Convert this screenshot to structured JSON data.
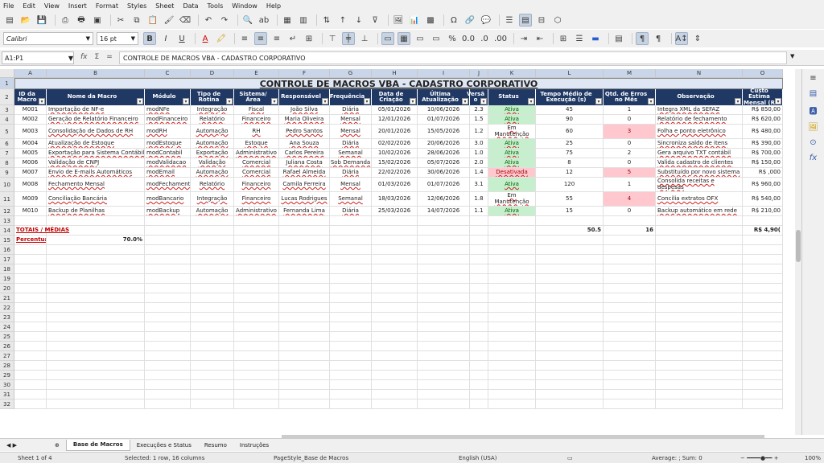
{
  "menu": [
    "File",
    "Edit",
    "View",
    "Insert",
    "Format",
    "Styles",
    "Sheet",
    "Data",
    "Tools",
    "Window",
    "Help"
  ],
  "font": {
    "name": "Calibri",
    "size": "16 pt"
  },
  "namebox": "A1:P1",
  "formula": "CONTROLE DE MACROS VBA - CADASTRO CORPORATIVO",
  "columns": [
    "A",
    "B",
    "C",
    "D",
    "E",
    "F",
    "G",
    "H",
    "I",
    "J",
    "K",
    "L",
    "M",
    "N",
    "O"
  ],
  "rows": [
    "1",
    "2",
    "3",
    "4",
    "5",
    "6",
    "7",
    "8",
    "9",
    "10",
    "11",
    "12",
    "13",
    "14",
    "15",
    "16",
    "17",
    "18",
    "19",
    "20",
    "21",
    "22",
    "23",
    "24",
    "25",
    "26",
    "27",
    "28",
    "29",
    "30",
    "31",
    "32"
  ],
  "title": "CONTROLE DE MACROS VBA - CADASTRO CORPORATIVO",
  "headers": [
    "ID da Macro",
    "Nome da Macro",
    "Módulo",
    "Tipo de Rotina",
    "Sistema/ Área",
    "Responsável",
    "Frequência",
    "Data de Criação",
    "Última Atualização",
    "Versã o",
    "Status",
    "Tempo Médio de Execução (s)",
    "Qtd. de Erros no Mês",
    "Observação",
    "Custo Estima Mensal (R"
  ],
  "data": [
    [
      "M001",
      "Importação de NF-e",
      "modNFe",
      "Integração",
      "Fiscal",
      "João Silva",
      "Diária",
      "05/01/2026",
      "10/06/2026",
      "2.3",
      "Ativa",
      "45",
      "1",
      "Integra XML da SEFAZ",
      "R$ 850,00"
    ],
    [
      "M002",
      "Geração de Relatório Financeiro",
      "modFinanceiro",
      "Relatório",
      "Financeiro",
      "Maria Oliveira",
      "Mensal",
      "12/01/2026",
      "01/07/2026",
      "1.5",
      "Ativa",
      "90",
      "0",
      "Relatório de fechamento",
      "R$ 620,00"
    ],
    [
      "M003",
      "Consolidação de Dados de RH",
      "modRH",
      "Automação",
      "RH",
      "Pedro Santos",
      "Mensal",
      "20/01/2026",
      "15/05/2026",
      "1.2",
      "Em Manutenção",
      "60",
      "3",
      "Folha e ponto eletrônico",
      "R$ 480,00"
    ],
    [
      "M004",
      "Atualização de Estoque",
      "modEstoque",
      "Automação",
      "Estoque",
      "Ana Souza",
      "Diária",
      "02/02/2026",
      "20/06/2026",
      "3.0",
      "Ativa",
      "25",
      "0",
      "Sincroniza saldo de itens",
      "R$ 390,00"
    ],
    [
      "M005",
      "Exportação para Sistema Contábil",
      "modContabil",
      "Exportação",
      "Administrativo",
      "Carlos Pereira",
      "Semanal",
      "10/02/2026",
      "28/06/2026",
      "1.0",
      "Ativa",
      "75",
      "2",
      "Gera arquivo TXT contábil",
      "R$ 700,00"
    ],
    [
      "M006",
      "Validação de CNPJ",
      "modValidacao",
      "Validação",
      "Comercial",
      "Juliana Costa",
      "Sob Demanda",
      "15/02/2026",
      "05/07/2026",
      "2.0",
      "Ativa",
      "8",
      "0",
      "Valida cadastro de clientes",
      "R$ 150,00"
    ],
    [
      "M007",
      "Envio de E-mails Automáticos",
      "modEmail",
      "Automação",
      "Comercial",
      "Rafael Almeida",
      "Diária",
      "22/02/2026",
      "30/06/2026",
      "1.4",
      "Desativada",
      "12",
      "5",
      "Substituído por novo sistema",
      "R$ ,000"
    ],
    [
      "M008",
      "Fechamento Mensal",
      "modFechamento",
      "Relatório",
      "Financeiro",
      "Camila Ferreira",
      "Mensal",
      "01/03/2026",
      "01/07/2026",
      "3.1",
      "Ativa",
      "120",
      "1",
      "Consolida receitas e despesas",
      "R$ 960,00"
    ],
    [
      "M009",
      "Conciliação Bancária",
      "modBancario",
      "Integração",
      "Financeiro",
      "Lucas Rodrigues",
      "Semanal",
      "18/03/2026",
      "12/06/2026",
      "1.8",
      "Em Manutenção",
      "55",
      "4",
      "Concilia extratos OFX",
      "R$ 540,00"
    ],
    [
      "M010",
      "Backup de Planilhas",
      "modBackup",
      "Automação",
      "Administrativo",
      "Fernanda Lima",
      "Diária",
      "25/03/2026",
      "14/07/2026",
      "1.1",
      "Ativa",
      "15",
      "0",
      "Backup automático em rede",
      "R$ 210,00"
    ]
  ],
  "totals": {
    "label": "TOTAIS / MÉDIAS",
    "avg_time": "50.5",
    "errors": "16",
    "cost": "R$ 4,90("
  },
  "percent": {
    "label": "Percentua",
    "value": "70.0%"
  },
  "tabs": [
    "Base de Macros",
    "Execuções e Status",
    "Resumo",
    "Instruções"
  ],
  "status": {
    "sheet": "Sheet 1 of 4",
    "selected": "Selected: 1 row, 16 columns",
    "pagestyle": "PageStyle_Base de Macros",
    "lang": "English (USA)",
    "sum": "Average: ; Sum: 0",
    "zoom": "100%"
  }
}
